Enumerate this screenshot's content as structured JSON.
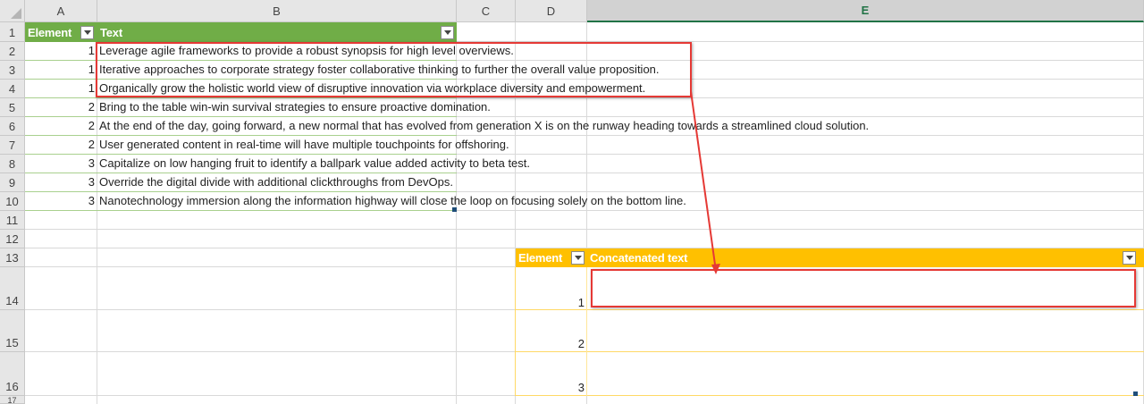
{
  "columns": [
    "A",
    "B",
    "C",
    "D",
    "E"
  ],
  "selected_column": "E",
  "rows": [
    "1",
    "2",
    "3",
    "4",
    "5",
    "6",
    "7",
    "8",
    "9",
    "10",
    "11",
    "12",
    "13",
    "14",
    "15",
    "16",
    "17"
  ],
  "table1": {
    "headers": [
      "Element",
      "Text"
    ],
    "rows": [
      {
        "element": "1",
        "text": "Leverage agile frameworks to provide a robust synopsis for high level overviews."
      },
      {
        "element": "1",
        "text": "Iterative approaches to corporate strategy foster collaborative thinking to further the overall value proposition."
      },
      {
        "element": "1",
        "text": "Organically grow the holistic world view of disruptive innovation via workplace diversity and empowerment."
      },
      {
        "element": "2",
        "text": "Bring to the table win-win survival strategies to ensure proactive domination."
      },
      {
        "element": "2",
        "text": "At the end of the day, going forward, a new normal that has evolved from generation X is on the runway heading towards a streamlined cloud solution."
      },
      {
        "element": "2",
        "text": "User generated content in real-time will have multiple touchpoints for offshoring."
      },
      {
        "element": "3",
        "text": "Capitalize on low hanging fruit to identify a ballpark value added activity to beta test."
      },
      {
        "element": "3",
        "text": "Override the digital divide with additional clickthroughs from DevOps."
      },
      {
        "element": "3",
        "text": "Nanotechnology immersion along the information highway will close the loop on focusing solely on the bottom line."
      }
    ]
  },
  "table2": {
    "headers": [
      "Element",
      "Concatenated text"
    ],
    "rows": [
      {
        "element": "1",
        "text": ""
      },
      {
        "element": "2",
        "text": ""
      },
      {
        "element": "3",
        "text": ""
      }
    ]
  },
  "colors": {
    "green_header": "#70ad47",
    "gold_header": "#ffc000",
    "highlight_red": "#e53935",
    "selected_col": "#217346"
  }
}
